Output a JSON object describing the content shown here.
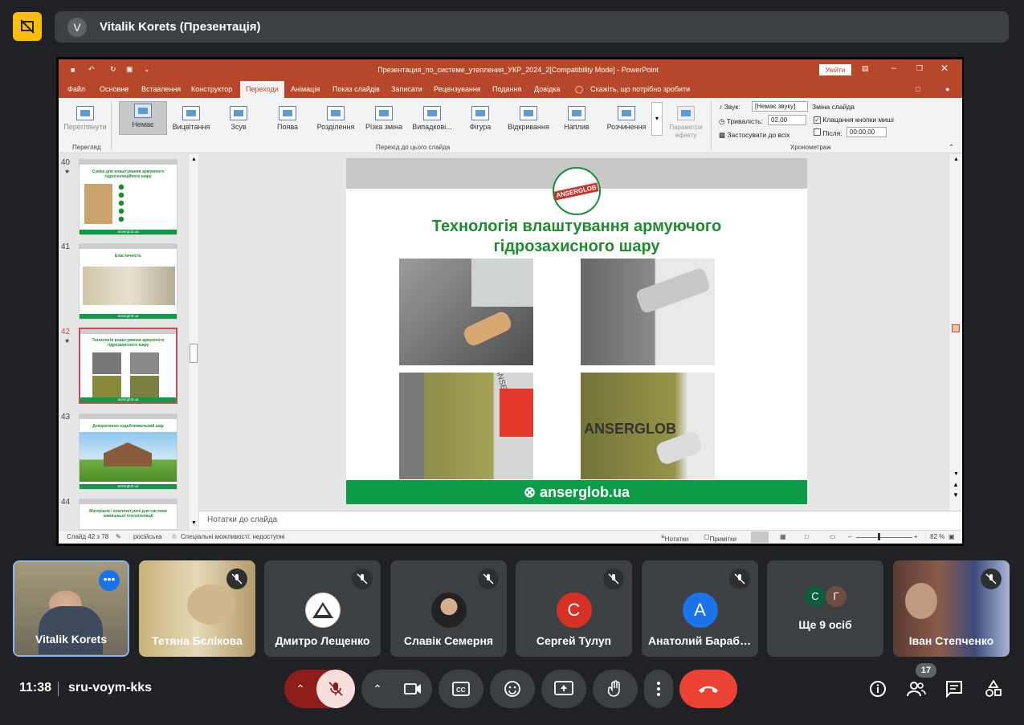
{
  "top": {
    "avatar": "V",
    "title": "Vitalik Korets (Презентація)"
  },
  "ppt": {
    "title": "Презентация_по_системе_утепления_УКР_2024_2[Compatibility Mode]  -  PowerPoint",
    "signin": "Увійти",
    "tabs": [
      "Файл",
      "Основне",
      "Вставлення",
      "Конструктор",
      "Переходи",
      "Анімація",
      "Показ слайдів",
      "Записати",
      "Рецензування",
      "Подання",
      "Довідка"
    ],
    "active_tab": "Переходи",
    "tellme": "Скажіть, що потрібно зробити",
    "preview_label": "Переглянути",
    "preview_group": "Перегляд",
    "transitions": [
      "Немає",
      "Вицвітання",
      "Зсув",
      "Поява",
      "Розділення",
      "Різка зміна",
      "Випадкові...",
      "Фігура",
      "Відкривання",
      "Наплив",
      "Розчинення"
    ],
    "transition_group": "Перехід до цього слайда",
    "effect_params": "Параметри ефекту",
    "sound_label": "Звук:",
    "sound_value": "[Немає звуку]",
    "duration_label": "Тривалість:",
    "duration_value": "02,00",
    "apply_all": "Застосувати до всіх",
    "advance_label": "Зміна слайда",
    "on_click": "Клацання кнопки миші",
    "after_label": "Після:",
    "after_value": "00:00,00",
    "timing_group": "Хронометраж",
    "slide_numbers": [
      "40",
      "41",
      "42",
      "43",
      "44"
    ],
    "thumb_titles": [
      "Суміш для влаштування армуючого гідроізоляційного шару",
      "Еластичність",
      "Технологія влаштування армуючого гідрозахисного шару",
      "Декоративно оздоблювальний шар",
      "Матеріали і комплектуючі для системи зовнішньої теплоізоляції"
    ],
    "thumb_foot": "anserglob.ua",
    "slide": {
      "logo": "ANSERGLOB",
      "title_line1": "Технологія влаштування армуючого",
      "title_line2": "гідрозахисного шару",
      "footer": "anserglob.ua",
      "photo_text": "ANSERGLOB"
    },
    "notes": "Нотатки до слайда",
    "status": {
      "slide": "Слайд 42 з 78",
      "lang": "російська",
      "access": "Спеціальні можливості: недоступні",
      "notes": "Нотатки",
      "comments": "Примітки",
      "zoom": "82 %"
    }
  },
  "participants": [
    {
      "name": "Vitalik Korets"
    },
    {
      "name": "Тетяна Бєлікова"
    },
    {
      "name": "Дмитро Лещенко"
    },
    {
      "name": "Славік Семерня"
    },
    {
      "name": "Сергей Тулуп",
      "initial": "С",
      "color": "#d93025"
    },
    {
      "name": "Анатолий Барабаш",
      "initial": "А",
      "color": "#1a73e8"
    },
    {
      "name": "Ще 9 осіб",
      "initials": [
        "С",
        "Г"
      ]
    },
    {
      "name": "Іван Степченко"
    }
  ],
  "bottom": {
    "time": "11:38",
    "code": "sru-voym-kks",
    "people_count": "17"
  },
  "colors": {
    "accent_yellow": "#fbbc04",
    "hangup": "#ea4335",
    "ppt": "#b7472a",
    "green": "#0c9b47"
  }
}
